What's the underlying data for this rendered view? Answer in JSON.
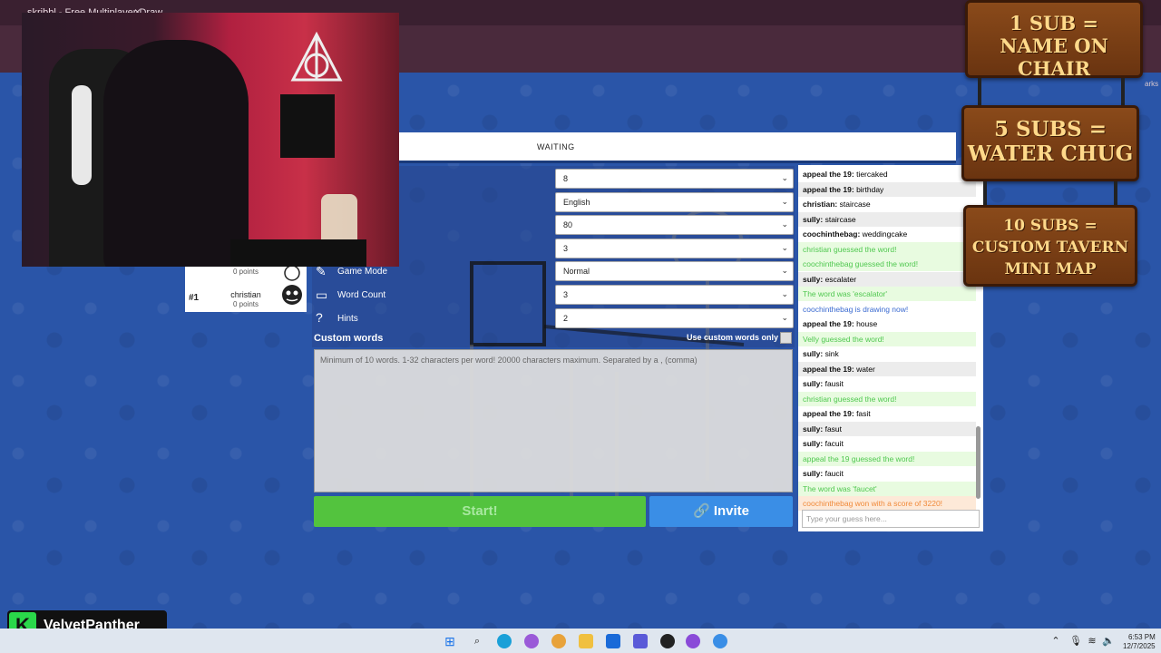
{
  "browser": {
    "tab_title": "skribbl - Free Multiplayer Draw...",
    "tab_close": "×",
    "bookmarks_label": "arks"
  },
  "game": {
    "status": "WAITING"
  },
  "players": [
    {
      "rank": "",
      "name": "",
      "points": "0 points"
    },
    {
      "rank": "#1",
      "name": "christian",
      "points": "0 points"
    }
  ],
  "settings": {
    "labels": {
      "game_mode": "Game Mode",
      "word_count": "Word Count",
      "hints": "Hints"
    },
    "selects": {
      "players": "8",
      "language": "English",
      "drawtime": "80",
      "rounds": "3",
      "game_mode": "Normal",
      "word_count": "3",
      "hints": "2"
    },
    "custom_words_title": "Custom words",
    "use_custom_words_only": "Use custom words only",
    "custom_words_placeholder": "Minimum of 10 words. 1-32 characters per word! 20000 characters maximum. Separated by a , (comma)",
    "start_label": "Start!",
    "invite_label": "Invite"
  },
  "chat": {
    "messages": [
      {
        "user": "appeal the 19:",
        "text": "tiercaked",
        "kind": "normal"
      },
      {
        "user": "appeal the 19:",
        "text": "birthday",
        "kind": "normal"
      },
      {
        "user": "christian:",
        "text": "staircase",
        "kind": "normal"
      },
      {
        "user": "sully:",
        "text": "staircase",
        "kind": "normal"
      },
      {
        "user": "coochinthebag:",
        "text": "weddingcake",
        "kind": "normal"
      },
      {
        "user": "",
        "text": "christian guessed the word!",
        "kind": "guess"
      },
      {
        "user": "",
        "text": "coochinthebag guessed the word!",
        "kind": "guess"
      },
      {
        "user": "sully:",
        "text": "escalater",
        "kind": "normal"
      },
      {
        "user": "",
        "text": "The word was 'escalator'",
        "kind": "guess"
      },
      {
        "user": "",
        "text": "coochinthebag is drawing now!",
        "kind": "drawing"
      },
      {
        "user": "appeal the 19:",
        "text": "house",
        "kind": "normal"
      },
      {
        "user": "",
        "text": "Velly guessed the word!",
        "kind": "guess"
      },
      {
        "user": "sully:",
        "text": "sink",
        "kind": "normal"
      },
      {
        "user": "appeal the 19:",
        "text": "water",
        "kind": "normal"
      },
      {
        "user": "sully:",
        "text": "fausit",
        "kind": "normal"
      },
      {
        "user": "",
        "text": "christian guessed the word!",
        "kind": "guess"
      },
      {
        "user": "appeal the 19:",
        "text": "fasit",
        "kind": "normal"
      },
      {
        "user": "sully:",
        "text": "fasut",
        "kind": "normal"
      },
      {
        "user": "sully:",
        "text": "facuit",
        "kind": "normal"
      },
      {
        "user": "",
        "text": "appeal the 19 guessed the word!",
        "kind": "guess"
      },
      {
        "user": "sully:",
        "text": "faucit",
        "kind": "normal"
      },
      {
        "user": "",
        "text": "The word was 'faucet'",
        "kind": "guess"
      },
      {
        "user": "",
        "text": "coochinthebag won with a score of 3220!",
        "kind": "win"
      }
    ],
    "input_placeholder": "Type your guess here..."
  },
  "sub_goals": [
    {
      "line1": "1 SUB =",
      "line2": "NAME ON CHAIR",
      "line3": ""
    },
    {
      "line1": "5 SUBS =",
      "line2": "WATER CHUG",
      "line3": ""
    },
    {
      "line1": "10 SUBS =",
      "line2": "CUSTOM TAVERN",
      "line3": "MINI MAP"
    }
  ],
  "streamer": {
    "logo_letter": "K",
    "name": "VelvetPanther"
  },
  "taskbar": {
    "time": "6:53 PM",
    "date": "12/7/2025"
  },
  "colors": {
    "start_green": "#53c33e",
    "invite_blue": "#3a8ee6",
    "guess_green": "#50c850",
    "drawing_blue": "#3a6ad0",
    "win_orange": "#f08a3a",
    "background_blue": "#2a55a8"
  }
}
